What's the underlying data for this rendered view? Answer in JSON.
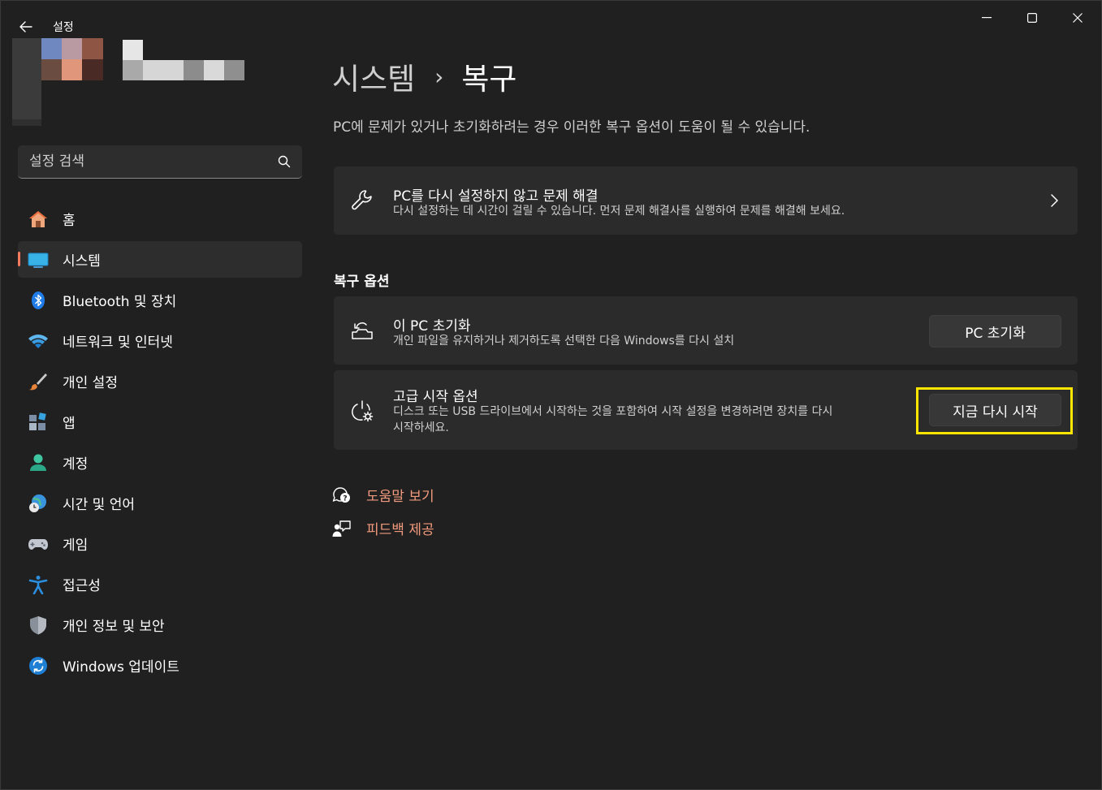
{
  "window": {
    "app_title": "설정",
    "back_icon": "arrow-left-icon",
    "controls": [
      "minimize-icon",
      "maximize-icon",
      "close-icon"
    ]
  },
  "account": {
    "avatar_icon": "blurred-profile-avatar"
  },
  "search": {
    "placeholder": "설정 검색",
    "icon": "search-icon"
  },
  "nav": {
    "items": [
      {
        "label": "홈",
        "icon": "home-icon",
        "active": false
      },
      {
        "label": "시스템",
        "icon": "system-monitor-icon",
        "active": true
      },
      {
        "label": "Bluetooth 및 장치",
        "icon": "bluetooth-icon",
        "active": false
      },
      {
        "label": "네트워크 및 인터넷",
        "icon": "wifi-icon",
        "active": false
      },
      {
        "label": "개인 설정",
        "icon": "paintbrush-icon",
        "active": false
      },
      {
        "label": "앱",
        "icon": "apps-icon",
        "active": false
      },
      {
        "label": "계정",
        "icon": "account-person-icon",
        "active": false
      },
      {
        "label": "시간 및 언어",
        "icon": "globe-clock-icon",
        "active": false
      },
      {
        "label": "게임",
        "icon": "gamepad-icon",
        "active": false
      },
      {
        "label": "접근성",
        "icon": "accessibility-icon",
        "active": false
      },
      {
        "label": "개인 정보 및 보안",
        "icon": "shield-icon",
        "active": false
      },
      {
        "label": "Windows 업데이트",
        "icon": "windows-update-icon",
        "active": false
      }
    ],
    "active_indicator_color": "#f47a5f"
  },
  "main": {
    "breadcrumb": {
      "parent": "시스템",
      "separator": "›",
      "current": "복구"
    },
    "description": "PC에 문제가 있거나 초기화하려는 경우 이러한 복구 옵션이 도움이 될 수 있습니다.",
    "troubleshoot_card": {
      "icon": "wrench-icon",
      "title": "PC를 다시 설정하지 않고 문제 해결",
      "subtitle": "다시 설정하는 데 시간이 걸릴 수 있습니다. 먼저 문제 해결사를 실행하여 문제를 해결해 보세요.",
      "chevron": "chevron-right-icon"
    },
    "section_title": "복구 옵션",
    "reset_card": {
      "icon": "reset-pc-icon",
      "title": "이 PC 초기화",
      "subtitle": "개인 파일을 유지하거나 제거하도록 선택한 다음 Windows를 다시 설치",
      "button": "PC 초기화"
    },
    "advanced_card": {
      "icon": "advanced-startup-icon",
      "title": "고급 시작 옵션",
      "subtitle_line1": "디스크 또는 USB 드라이브에서 시작하는 것을 포함하여 시작 설정을 변경하려면 장치를 다시",
      "subtitle_line2": "시작하세요.",
      "button": "지금 다시 시작",
      "highlight_color": "#ffe600"
    },
    "links": [
      {
        "label": "도움말 보기",
        "icon": "help-chat-icon"
      },
      {
        "label": "피드백 제공",
        "icon": "feedback-person-icon"
      }
    ],
    "link_color": "#f0997c"
  }
}
